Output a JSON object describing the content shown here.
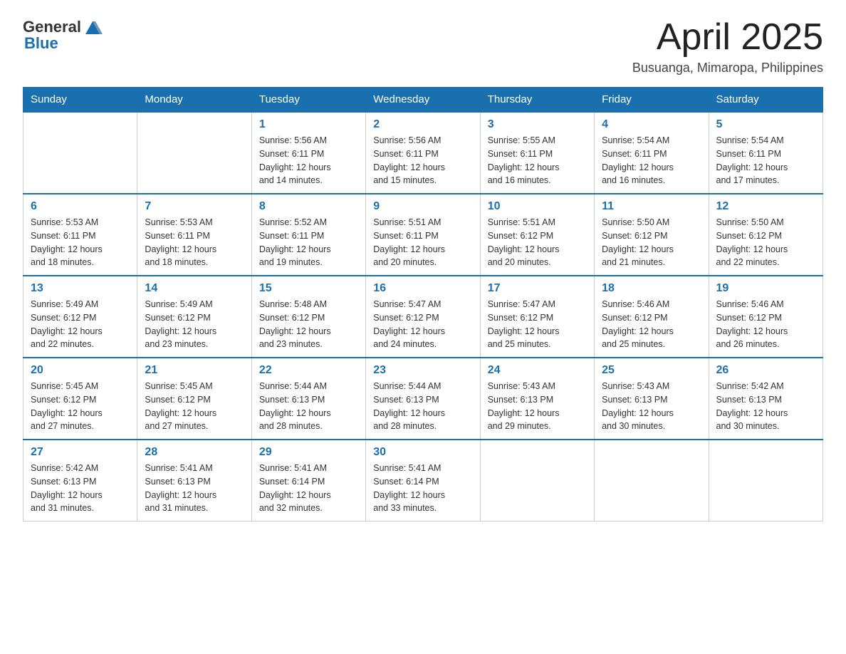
{
  "header": {
    "logo_general": "General",
    "logo_blue": "Blue",
    "title": "April 2025",
    "location": "Busuanga, Mimaropa, Philippines"
  },
  "days_of_week": [
    "Sunday",
    "Monday",
    "Tuesday",
    "Wednesday",
    "Thursday",
    "Friday",
    "Saturday"
  ],
  "weeks": [
    [
      {
        "day": "",
        "info": ""
      },
      {
        "day": "",
        "info": ""
      },
      {
        "day": "1",
        "info": "Sunrise: 5:56 AM\nSunset: 6:11 PM\nDaylight: 12 hours\nand 14 minutes."
      },
      {
        "day": "2",
        "info": "Sunrise: 5:56 AM\nSunset: 6:11 PM\nDaylight: 12 hours\nand 15 minutes."
      },
      {
        "day": "3",
        "info": "Sunrise: 5:55 AM\nSunset: 6:11 PM\nDaylight: 12 hours\nand 16 minutes."
      },
      {
        "day": "4",
        "info": "Sunrise: 5:54 AM\nSunset: 6:11 PM\nDaylight: 12 hours\nand 16 minutes."
      },
      {
        "day": "5",
        "info": "Sunrise: 5:54 AM\nSunset: 6:11 PM\nDaylight: 12 hours\nand 17 minutes."
      }
    ],
    [
      {
        "day": "6",
        "info": "Sunrise: 5:53 AM\nSunset: 6:11 PM\nDaylight: 12 hours\nand 18 minutes."
      },
      {
        "day": "7",
        "info": "Sunrise: 5:53 AM\nSunset: 6:11 PM\nDaylight: 12 hours\nand 18 minutes."
      },
      {
        "day": "8",
        "info": "Sunrise: 5:52 AM\nSunset: 6:11 PM\nDaylight: 12 hours\nand 19 minutes."
      },
      {
        "day": "9",
        "info": "Sunrise: 5:51 AM\nSunset: 6:11 PM\nDaylight: 12 hours\nand 20 minutes."
      },
      {
        "day": "10",
        "info": "Sunrise: 5:51 AM\nSunset: 6:12 PM\nDaylight: 12 hours\nand 20 minutes."
      },
      {
        "day": "11",
        "info": "Sunrise: 5:50 AM\nSunset: 6:12 PM\nDaylight: 12 hours\nand 21 minutes."
      },
      {
        "day": "12",
        "info": "Sunrise: 5:50 AM\nSunset: 6:12 PM\nDaylight: 12 hours\nand 22 minutes."
      }
    ],
    [
      {
        "day": "13",
        "info": "Sunrise: 5:49 AM\nSunset: 6:12 PM\nDaylight: 12 hours\nand 22 minutes."
      },
      {
        "day": "14",
        "info": "Sunrise: 5:49 AM\nSunset: 6:12 PM\nDaylight: 12 hours\nand 23 minutes."
      },
      {
        "day": "15",
        "info": "Sunrise: 5:48 AM\nSunset: 6:12 PM\nDaylight: 12 hours\nand 23 minutes."
      },
      {
        "day": "16",
        "info": "Sunrise: 5:47 AM\nSunset: 6:12 PM\nDaylight: 12 hours\nand 24 minutes."
      },
      {
        "day": "17",
        "info": "Sunrise: 5:47 AM\nSunset: 6:12 PM\nDaylight: 12 hours\nand 25 minutes."
      },
      {
        "day": "18",
        "info": "Sunrise: 5:46 AM\nSunset: 6:12 PM\nDaylight: 12 hours\nand 25 minutes."
      },
      {
        "day": "19",
        "info": "Sunrise: 5:46 AM\nSunset: 6:12 PM\nDaylight: 12 hours\nand 26 minutes."
      }
    ],
    [
      {
        "day": "20",
        "info": "Sunrise: 5:45 AM\nSunset: 6:12 PM\nDaylight: 12 hours\nand 27 minutes."
      },
      {
        "day": "21",
        "info": "Sunrise: 5:45 AM\nSunset: 6:12 PM\nDaylight: 12 hours\nand 27 minutes."
      },
      {
        "day": "22",
        "info": "Sunrise: 5:44 AM\nSunset: 6:13 PM\nDaylight: 12 hours\nand 28 minutes."
      },
      {
        "day": "23",
        "info": "Sunrise: 5:44 AM\nSunset: 6:13 PM\nDaylight: 12 hours\nand 28 minutes."
      },
      {
        "day": "24",
        "info": "Sunrise: 5:43 AM\nSunset: 6:13 PM\nDaylight: 12 hours\nand 29 minutes."
      },
      {
        "day": "25",
        "info": "Sunrise: 5:43 AM\nSunset: 6:13 PM\nDaylight: 12 hours\nand 30 minutes."
      },
      {
        "day": "26",
        "info": "Sunrise: 5:42 AM\nSunset: 6:13 PM\nDaylight: 12 hours\nand 30 minutes."
      }
    ],
    [
      {
        "day": "27",
        "info": "Sunrise: 5:42 AM\nSunset: 6:13 PM\nDaylight: 12 hours\nand 31 minutes."
      },
      {
        "day": "28",
        "info": "Sunrise: 5:41 AM\nSunset: 6:13 PM\nDaylight: 12 hours\nand 31 minutes."
      },
      {
        "day": "29",
        "info": "Sunrise: 5:41 AM\nSunset: 6:14 PM\nDaylight: 12 hours\nand 32 minutes."
      },
      {
        "day": "30",
        "info": "Sunrise: 5:41 AM\nSunset: 6:14 PM\nDaylight: 12 hours\nand 33 minutes."
      },
      {
        "day": "",
        "info": ""
      },
      {
        "day": "",
        "info": ""
      },
      {
        "day": "",
        "info": ""
      }
    ]
  ]
}
